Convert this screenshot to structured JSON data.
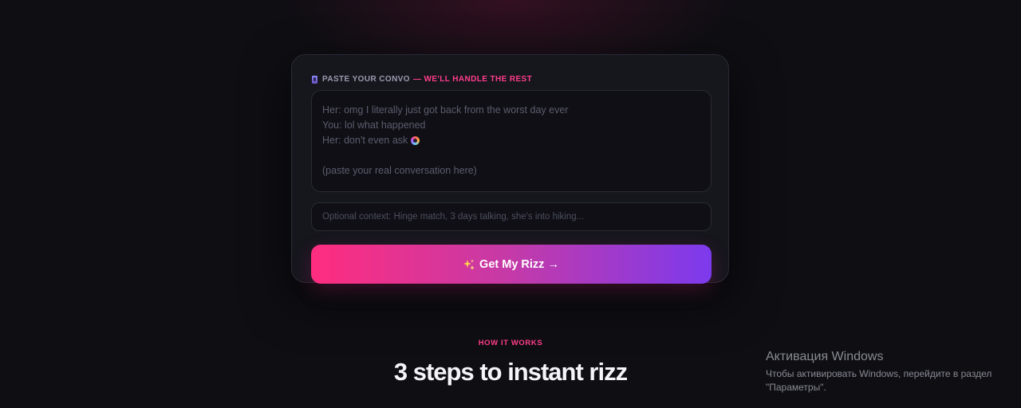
{
  "card": {
    "label_main": "PASTE YOUR CONVO",
    "label_accent": "— WE'LL HANDLE THE REST",
    "convo_lines": [
      "Her: omg I literally just got back from the worst day ever",
      "You: lol what happened",
      "Her: don't even ask",
      "(paste your real conversation here)"
    ],
    "context_placeholder": "Optional context: Hinge match, 3 days talking, she's into hiking...",
    "cta_label": "Get My Rizz →"
  },
  "how_it_works": {
    "label": "HOW IT WORKS",
    "heading": "3 steps to instant rizz"
  },
  "windows_activation": {
    "title": "Активация Windows",
    "text": "Чтобы активировать Windows, перейдите в раздел \"Параметры\"."
  },
  "colors": {
    "accent_pink": "#ff3d8b",
    "gradient_start": "#ff2d7f",
    "gradient_end": "#7c3aed",
    "background": "#0e0e13",
    "card_background": "#16161d"
  },
  "icons": {
    "label_icon": "phone-icon",
    "emoji_icon": "face-emoji-icon",
    "cta_icon": "sparkles-icon"
  }
}
